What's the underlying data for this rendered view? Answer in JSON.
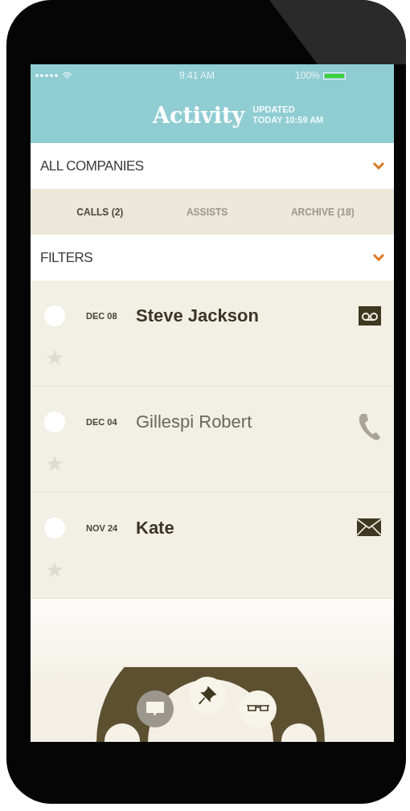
{
  "status_bar": {
    "time": "9:41 AM",
    "battery": "100%"
  },
  "header": {
    "title": "Activity",
    "updated_label": "UPDATED",
    "updated_time": "TODAY 10:59 AM"
  },
  "company_picker": {
    "label": "ALL COMPANIES"
  },
  "tabs": [
    {
      "label": "CALLS (2)",
      "selected": true
    },
    {
      "label": "ASSISTS",
      "selected": false
    },
    {
      "label": "ARCHIVE (18)",
      "selected": false
    }
  ],
  "filters": {
    "label": "FILTERS"
  },
  "activities": [
    {
      "date": "DEC 08",
      "name": "Steve Jackson",
      "unread": true,
      "checked": false,
      "starred": false,
      "kind": "voicemail"
    },
    {
      "date": "DEC 04",
      "name": "Gillespi Robert",
      "unread": false,
      "checked": false,
      "starred": false,
      "kind": "call"
    },
    {
      "date": "NOV 24",
      "name": "Kate",
      "unread": true,
      "checked": false,
      "starred": false,
      "kind": "message"
    }
  ],
  "dial": [
    {
      "kind": "chat",
      "selected": true
    },
    {
      "kind": "pin",
      "selected": false
    },
    {
      "kind": "glasses",
      "selected": false
    }
  ]
}
